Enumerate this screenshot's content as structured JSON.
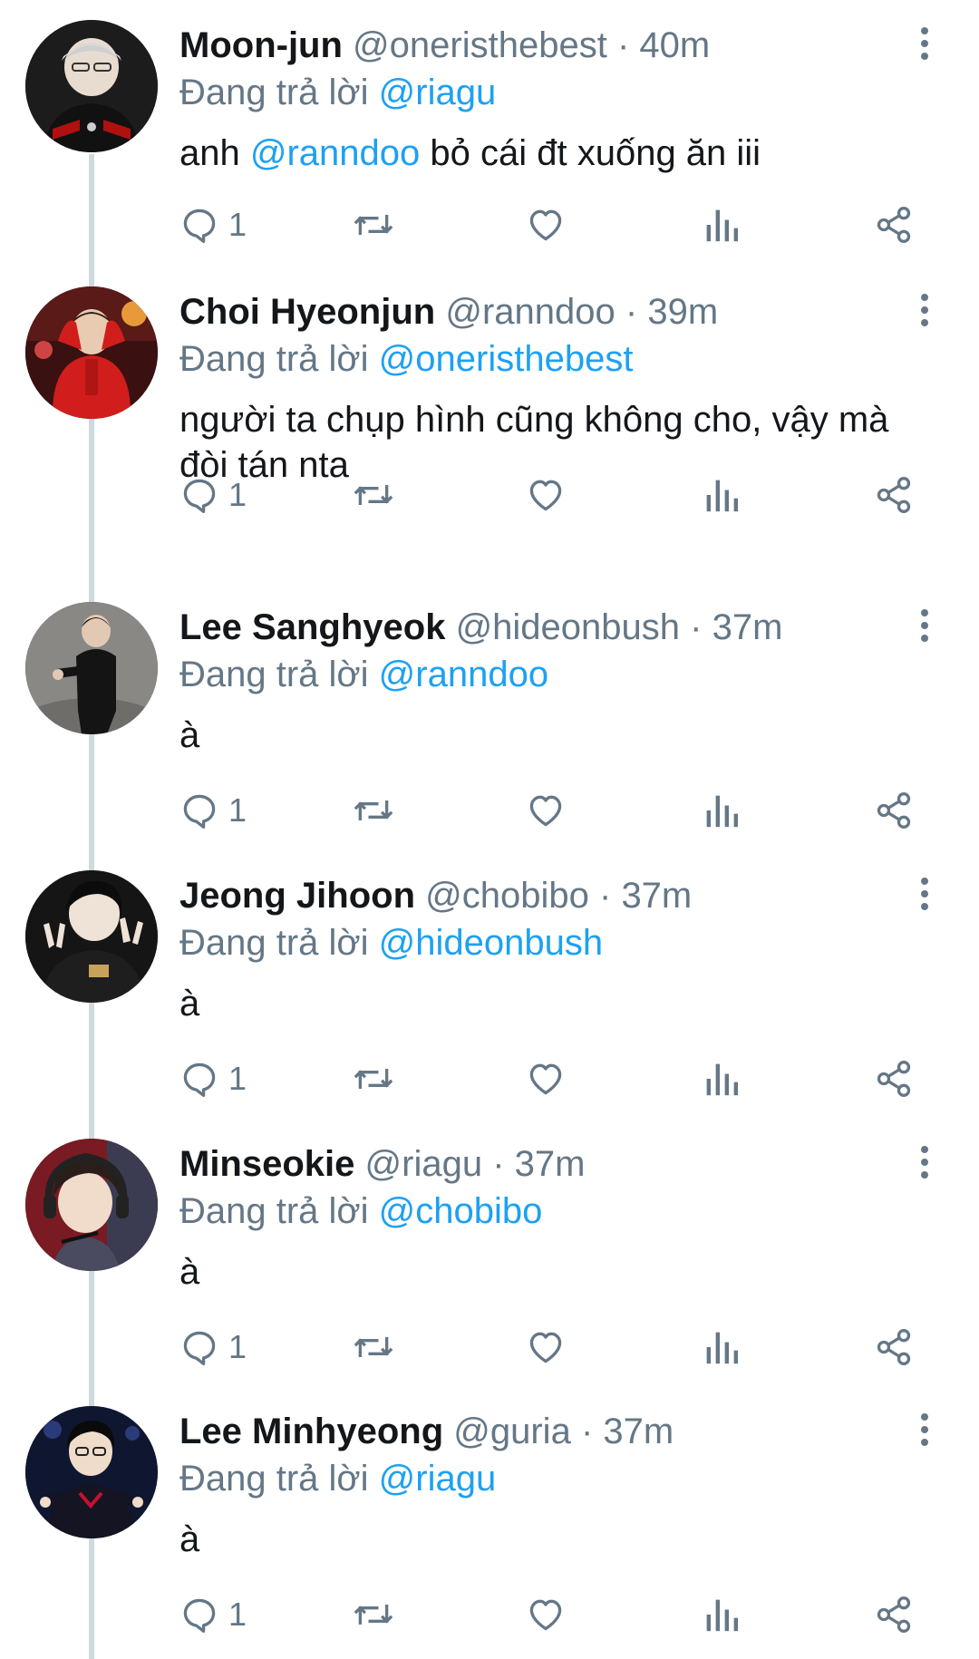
{
  "tweets": [
    {
      "name": "Moon-jun",
      "handle": "@oneristhebest",
      "dot": "·",
      "time": "40m",
      "replying_prefix": "Đang trả lời",
      "replying_to": "@riagu",
      "text_parts": [
        "anh ",
        "@ranndoo",
        " bỏ cái đt xuống ăn iii"
      ],
      "reply_count": "1"
    },
    {
      "name": "Choi Hyeonjun",
      "handle": "@ranndoo",
      "dot": "·",
      "time": "39m",
      "replying_prefix": "Đang trả lời",
      "replying_to": "@oneristhebest",
      "text_parts": [
        "người ta chụp hình cũng không cho, vậy mà đòi tán nta",
        "",
        ""
      ],
      "reply_count": "1"
    },
    {
      "name": "Lee Sanghyeok",
      "handle": "@hideonbush",
      "dot": "·",
      "time": "37m",
      "replying_prefix": "Đang trả lời",
      "replying_to": "@ranndoo",
      "text_parts": [
        "à",
        "",
        ""
      ],
      "reply_count": "1"
    },
    {
      "name": "Jeong Jihoon",
      "handle": "@chobibo",
      "dot": "·",
      "time": "37m",
      "replying_prefix": "Đang trả lời",
      "replying_to": "@hideonbush",
      "text_parts": [
        "à",
        "",
        ""
      ],
      "reply_count": "1"
    },
    {
      "name": "Minseokie",
      "handle": "@riagu",
      "dot": "·",
      "time": "37m",
      "replying_prefix": "Đang trả lời",
      "replying_to": "@chobibo",
      "text_parts": [
        "à",
        "",
        ""
      ],
      "reply_count": "1"
    },
    {
      "name": "Lee Minhyeong",
      "handle": "@guria",
      "dot": "·",
      "time": "37m",
      "replying_prefix": "Đang trả lời",
      "replying_to": "@riagu",
      "text_parts": [
        "à",
        "",
        ""
      ],
      "reply_count": "1"
    }
  ],
  "icons": {
    "reply": "reply-icon",
    "retweet": "retweet-icon",
    "like": "heart-icon",
    "views": "bar-chart-icon",
    "share": "share-icon",
    "more": "more-vertical-icon"
  },
  "colors": {
    "mention": "#1da1f2",
    "secondary_text": "#657786",
    "primary_text": "#14171a",
    "thread_line": "#cfd9de"
  }
}
